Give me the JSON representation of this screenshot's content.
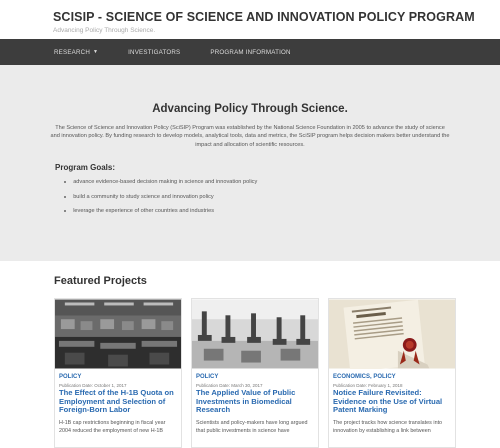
{
  "header": {
    "title": "SCISIP - SCIENCE OF SCIENCE AND INNOVATION POLICY PROGRAM",
    "tagline": "Advancing Policy Through Science."
  },
  "nav": {
    "items": [
      {
        "label": "RESEARCH",
        "has_dropdown": true
      },
      {
        "label": "INVESTIGATORS"
      },
      {
        "label": "PROGRAM INFORMATION"
      }
    ]
  },
  "hero": {
    "heading": "Advancing Policy Through Science.",
    "body": "The Science of Science and Innovation Policy (SciSIP) Program was established by the National Science Foundation in 2005 to advance the study of science and innovation policy. By funding research to develop models, analytical tools, data and metrics, the SciSIP program helps decision makers better understand the impact and allocation of scientific resources.",
    "goals_title": "Program Goals:",
    "goals": [
      "advance evidence-based decision making in science and innovation policy",
      "build a community to study science and innovation policy",
      "leverage the experience of other countries and industries"
    ]
  },
  "featured": {
    "title": "Featured Projects",
    "cards": [
      {
        "category": "POLICY",
        "date": "Publication Date: October 1, 2017",
        "title": "The Effect of the H-1B Quota on Employment and Selection of Foreign-Born Labor",
        "excerpt": "H-1B cap restrictions beginning in fiscal year 2004 reduced the employment of new H-1B"
      },
      {
        "category": "POLICY",
        "date": "Publication Date: March 30, 2017",
        "title": "The Applied Value of Public Investments in Biomedical Research",
        "excerpt": "Scientists and policy-makers have long argued that public investments in science have"
      },
      {
        "category": "ECONOMICS, POLICY",
        "date": "Publication Date: February 1, 2018",
        "title": "Notice Failure Revisited: Evidence on the Use of Virtual Patent Marking",
        "excerpt": "The project tracks how science translates into innovation by establishing a link between"
      }
    ]
  },
  "colors": {
    "nav_bg": "#3d3d3d",
    "hero_bg": "#ebebeb",
    "link_blue": "#2a6ab0"
  }
}
